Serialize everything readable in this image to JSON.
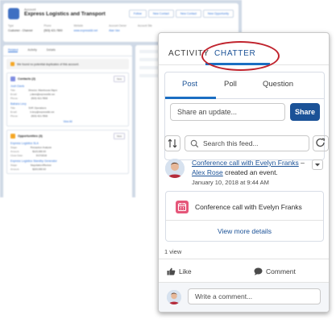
{
  "background_page": {
    "breadcrumb": "Account",
    "title": "Express Logistics and Transport",
    "header_buttons": [
      "Follow",
      "New Contact",
      "New Contact",
      "New Opportunity"
    ],
    "fields": [
      {
        "label": "Type",
        "value": "Customer - Channel",
        "link": false
      },
      {
        "label": "Phone",
        "value": "(503) 421-7800",
        "link": false
      },
      {
        "label": "Website",
        "value": "www.expressl&t.net",
        "link": true
      },
      {
        "label": "Account Owner",
        "value": "Alan Van",
        "link": true
      },
      {
        "label": "Account Site",
        "value": "",
        "link": false
      }
    ],
    "tabs": [
      "Related",
      "Activity",
      "Details"
    ],
    "duplicate_notice": "We found no potential duplicates of this account.",
    "contacts_card": {
      "title": "Contacts (2)",
      "new_label": "New",
      "rows": [
        {
          "name": "Josh Davis",
          "kv": [
            [
              "Title:",
              "Director, Warehouse Mgmt"
            ],
            [
              "Email:",
              "j.davis@expressl&t.net"
            ],
            [
              "Phone:",
              "(503) 421-7800"
            ]
          ]
        },
        {
          "name": "Babara Levy",
          "kv": [
            [
              "Title:",
              "SVP, Operations"
            ],
            [
              "Email:",
              "b.levy@expressl&t.net"
            ],
            [
              "Phone:",
              "(503) 421-7800"
            ]
          ]
        }
      ],
      "view_all": "View All"
    },
    "opportunities_card": {
      "title": "Opportunities (3)",
      "new_label": "New",
      "rows": [
        {
          "name": "Express Logistics SLA",
          "kv": [
            [
              "Stage:",
              "Perception Analysis"
            ],
            [
              "Amount:",
              "$120,000.00"
            ],
            [
              "Close Date:",
              "5/17/2016"
            ]
          ]
        },
        {
          "name": "Express Logistics Standby Generator",
          "kv": [
            [
              "Stage:",
              "Negotiation/Review"
            ],
            [
              "Amount:",
              "$220,000.00"
            ]
          ]
        }
      ]
    }
  },
  "panel": {
    "tabs": {
      "activity": "ACTIVITY",
      "chatter": "CHATTER"
    },
    "composer": {
      "tabs": {
        "post": "Post",
        "poll": "Poll",
        "question": "Question"
      },
      "share_placeholder": "Share an update...",
      "share_button": "Share"
    },
    "search_placeholder": "Search this feed...",
    "feed_item": {
      "author_link": "Conference call with Evelyn Franks",
      "separator": " – ",
      "owner_link": "Alex Rose",
      "action_text": " created an event.",
      "timestamp": "January 10, 2018 at 9:44 AM",
      "event_title": "Conference call with Evelyn Franks",
      "view_more": "View more details",
      "views": "1 view"
    },
    "actions": {
      "like": "Like",
      "comment": "Comment"
    },
    "comment_placeholder": "Write a comment..."
  },
  "colors": {
    "brand_blue": "#1b5297",
    "tab_underline": "#1b6ec2",
    "highlight_oval": "#c0232d",
    "event_icon": "#e55679",
    "warning": "#f5a623"
  },
  "icons": [
    "sort-icon",
    "search-icon",
    "refresh-icon",
    "chevron-down-icon",
    "calendar-icon",
    "like-icon",
    "comment-icon",
    "account-icon",
    "contacts-icon",
    "opportunities-icon"
  ]
}
